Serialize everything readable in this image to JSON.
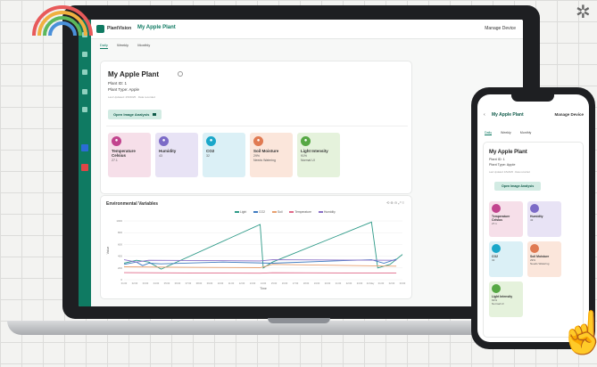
{
  "app": {
    "brand": "PlantVision",
    "page_title": "My Apple Plant",
    "manage_label": "Manage Device"
  },
  "tabs": [
    "Daily",
    "Weekly",
    "Monthly"
  ],
  "plant": {
    "name": "My Apple Plant",
    "id_line": "Plant ID: 1",
    "type_line": "Plant Type: Apple",
    "updated": "Last Updated: 4/5/2025 · Data recorded",
    "analysis_button": "Open Image Analysis"
  },
  "metrics": [
    {
      "label": "Temperature Celsius",
      "value": "27.1",
      "status": "",
      "color": "#c2448e",
      "bg": "#f6dfe9"
    },
    {
      "label": "Humidity",
      "value": "43",
      "status": "",
      "color": "#7c6bc7",
      "bg": "#e8e3f5"
    },
    {
      "label": "CO2",
      "value": "32",
      "status": "",
      "color": "#1aa7c9",
      "bg": "#dbf0f6"
    },
    {
      "label": "Soil Moisture",
      "value": "29%",
      "status": "Needs Watering",
      "color": "#e07a52",
      "bg": "#fbe6db"
    },
    {
      "label": "Light Intensity",
      "value": "91%",
      "status": "Normal UI",
      "color": "#56a844",
      "bg": "#e5f2dc"
    }
  ],
  "chart_section": {
    "title": "Environmental Variables",
    "tools": "⟲ ⊕ ⊖ ⤢ ≡"
  },
  "chart_data": {
    "type": "line",
    "series": [
      {
        "name": "Light",
        "color": "#2e9a88"
      },
      {
        "name": "CO2",
        "color": "#3f7bc0"
      },
      {
        "name": "Soil",
        "color": "#e8a070"
      },
      {
        "name": "Temperature",
        "color": "#e06a8a"
      },
      {
        "name": "Humidity",
        "color": "#8a6fc6"
      }
    ],
    "ylabel": "Value",
    "xlabel": "Time",
    "x_ticks": [
      "01:00",
      "02:00",
      "03:00",
      "04:00",
      "05:00",
      "06:00",
      "07:00",
      "08:00",
      "09:00",
      "10:00",
      "11:00",
      "12:00",
      "13:00",
      "14:00",
      "15:00",
      "16:00",
      "17:00",
      "18:00",
      "19:00",
      "20:00",
      "21:00",
      "22:00",
      "23:00",
      "24 May",
      "01:00",
      "02:00",
      "03:00"
    ],
    "y_ticks": [
      "1000",
      "800",
      "600",
      "400",
      "200",
      "0"
    ],
    "ylim": [
      0,
      1000
    ],
    "paths": {
      "Light": [
        [
          0,
          280
        ],
        [
          2,
          330
        ],
        [
          4,
          300
        ],
        [
          6,
          180
        ],
        [
          22,
          940
        ],
        [
          22.5,
          200
        ],
        [
          24,
          300
        ],
        [
          40,
          980
        ],
        [
          41,
          200
        ],
        [
          43,
          260
        ],
        [
          45,
          430
        ]
      ],
      "CO2": [
        [
          0,
          260
        ],
        [
          2,
          300
        ],
        [
          3,
          240
        ],
        [
          4,
          280
        ],
        [
          6,
          270
        ],
        [
          16,
          300
        ],
        [
          24,
          280
        ],
        [
          34,
          320
        ],
        [
          40,
          340
        ],
        [
          42,
          280
        ],
        [
          44,
          350
        ]
      ],
      "Soil": [
        [
          0,
          220
        ],
        [
          10,
          210
        ],
        [
          22,
          205
        ],
        [
          24,
          260
        ],
        [
          44,
          230
        ]
      ],
      "Temperature": [
        [
          0,
          120
        ],
        [
          10,
          115
        ],
        [
          22,
          110
        ],
        [
          24,
          118
        ],
        [
          44,
          112
        ]
      ],
      "Humidity": [
        [
          0,
          340
        ],
        [
          2,
          300
        ],
        [
          4,
          330
        ],
        [
          22,
          320
        ],
        [
          24,
          340
        ],
        [
          44,
          330
        ]
      ]
    },
    "x_range": [
      0,
      45
    ]
  },
  "phone": {
    "time_tabs": [
      "Daily",
      "Weekly",
      "Monthly"
    ]
  }
}
